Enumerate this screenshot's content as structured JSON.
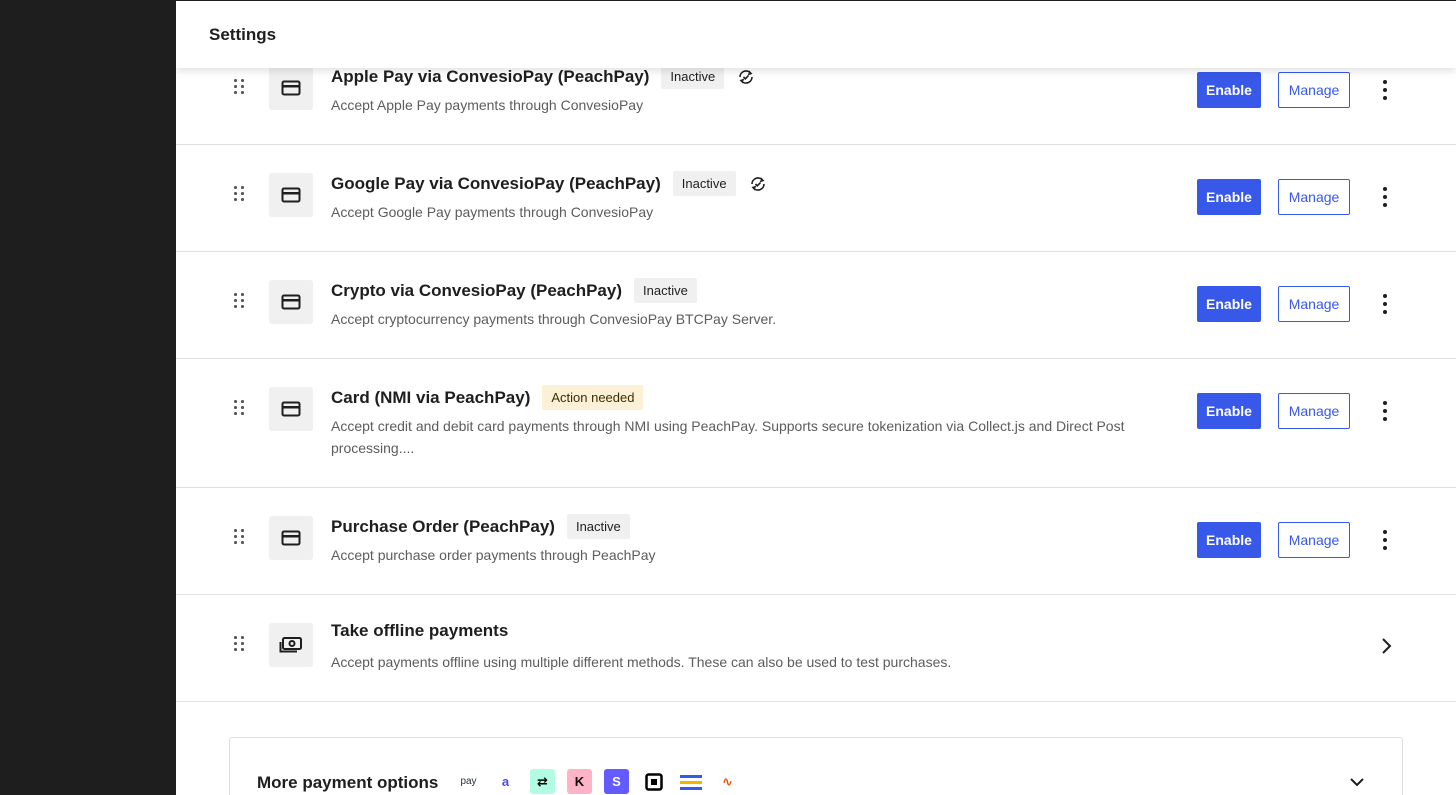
{
  "header": {
    "title": "Settings"
  },
  "payment_methods": [
    {
      "title": "Apple Pay via ConvesioPay (PeachPay)",
      "status": "Inactive",
      "status_type": "neutral",
      "sync_icon": true,
      "description": "Accept Apple Pay payments through ConvesioPay",
      "enable_label": "Enable",
      "manage_label": "Manage",
      "icon": "credit-card-icon"
    },
    {
      "title": "Google Pay via ConvesioPay (PeachPay)",
      "status": "Inactive",
      "status_type": "neutral",
      "sync_icon": true,
      "description": "Accept Google Pay payments through ConvesioPay",
      "enable_label": "Enable",
      "manage_label": "Manage",
      "icon": "credit-card-icon"
    },
    {
      "title": "Crypto via ConvesioPay (PeachPay)",
      "status": "Inactive",
      "status_type": "neutral",
      "sync_icon": false,
      "description": "Accept cryptocurrency payments through ConvesioPay BTCPay Server.",
      "enable_label": "Enable",
      "manage_label": "Manage",
      "icon": "credit-card-icon"
    },
    {
      "title": "Card (NMI via PeachPay)",
      "status": "Action needed",
      "status_type": "warning",
      "sync_icon": false,
      "description": "Accept credit and debit card payments through NMI using PeachPay. Supports secure tokenization via Collect.js and Direct Post processing....",
      "enable_label": "Enable",
      "manage_label": "Manage",
      "icon": "credit-card-icon"
    },
    {
      "title": "Purchase Order (PeachPay)",
      "status": "Inactive",
      "status_type": "neutral",
      "sync_icon": false,
      "description": "Accept purchase order payments through PeachPay",
      "enable_label": "Enable",
      "manage_label": "Manage",
      "icon": "credit-card-icon"
    }
  ],
  "offline": {
    "title": "Take offline payments",
    "description": "Accept payments offline using multiple different methods. These can also be used to test purchases.",
    "icon": "cash-icon"
  },
  "more_options": {
    "title": "More payment options",
    "logos": [
      {
        "name": "amazon-pay-logo",
        "text": "pay",
        "bg": "#ffffff",
        "fg": "#232f3e"
      },
      {
        "name": "affirm-logo",
        "text": "a",
        "bg": "#ffffff",
        "fg": "#4a4af4"
      },
      {
        "name": "afterpay-logo",
        "text": "⇄",
        "bg": "#b2fce4",
        "fg": "#000000"
      },
      {
        "name": "klarna-logo",
        "text": "K",
        "bg": "#ffb3c7",
        "fg": "#0a0b09"
      },
      {
        "name": "stripe-logo",
        "text": "S",
        "bg": "#635bff",
        "fg": "#ffffff"
      },
      {
        "name": "square-logo",
        "text": "",
        "bg": "#ffffff",
        "fg": "#000000"
      },
      {
        "name": "paystack-logo",
        "text": "",
        "bg": "#ffffff",
        "fg": "#3858e9"
      },
      {
        "name": "payoneer-logo",
        "text": "∿",
        "bg": "#ffffff",
        "fg": "#ff4800"
      }
    ]
  },
  "colors": {
    "primary": "#3858e9",
    "badge_neutral": "#f0f0f0",
    "badge_warning": "#fcf0d6",
    "sidebar": "#1e1e1e"
  }
}
